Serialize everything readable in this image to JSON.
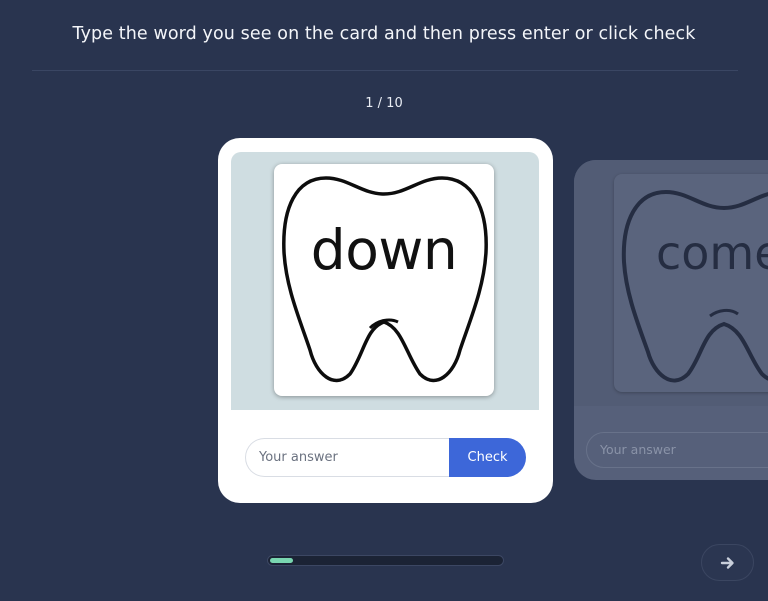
{
  "instruction": "Type the word you see on the card and then press enter or click check",
  "counter": "1 / 10",
  "current_card": {
    "word": "down",
    "answer_placeholder": "Your answer",
    "check_label": "Check"
  },
  "next_card": {
    "word": "come",
    "answer_placeholder": "Your answer"
  },
  "progress": {
    "fraction": 0.1
  },
  "icons": {
    "next": "arrow-right-icon",
    "tooth": "tooth-outline-icon"
  },
  "colors": {
    "background": "#29344f",
    "accent": "#3d67d9",
    "progress_fill": "#79d6b0"
  }
}
